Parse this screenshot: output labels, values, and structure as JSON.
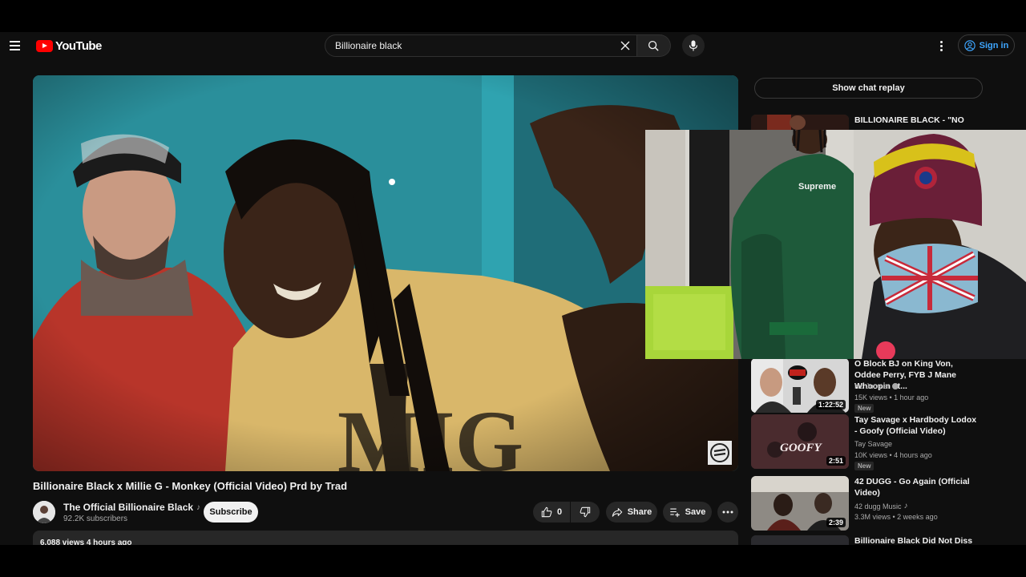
{
  "header": {
    "logo_text": "YouTube",
    "search_value": "Billionaire black",
    "signin_label": "Sign in"
  },
  "video": {
    "title": "Billionaire Black x Millie G - Monkey (Official Video) Prd by Trad",
    "channel": "The Official Billionaire Black",
    "subscribers": "92.2K subscribers",
    "subscribe_label": "Subscribe",
    "likes": "0",
    "share_label": "Share",
    "save_label": "Save",
    "views_meta": "6,088 views  4 hours ago"
  },
  "sidebar": {
    "chat_label": "Show chat replay",
    "items": [
      {
        "title": "BILLIONAIRE BLACK - \"NO",
        "channel": "",
        "stats": "",
        "duration": "",
        "badge": ""
      },
      {
        "title": "O Block BJ on King Von, Oddee Perry, FYB J Mane Whoopin at...",
        "channel": "No Jumper",
        "stats": "15K views • 1 hour ago",
        "duration": "1:22:52",
        "badge": "New"
      },
      {
        "title": "Tay Savage x Hardbody Lodox - Goofy (Official Video)",
        "channel": "Tay Savage",
        "stats": "10K views • 4 hours ago",
        "duration": "2:51",
        "badge": "New",
        "thumb_text": "GOOFY"
      },
      {
        "title": "42 DUGG - Go Again (Official Video)",
        "channel": "42 dugg Music",
        "stats": "3.3M views • 2 weeks ago",
        "duration": "2:39",
        "badge": ""
      },
      {
        "title": "Billionaire Black Did Not Diss",
        "channel": "",
        "stats": "",
        "duration": "",
        "badge": ""
      }
    ]
  },
  "pip": {
    "shirt_text": "Supreme"
  }
}
